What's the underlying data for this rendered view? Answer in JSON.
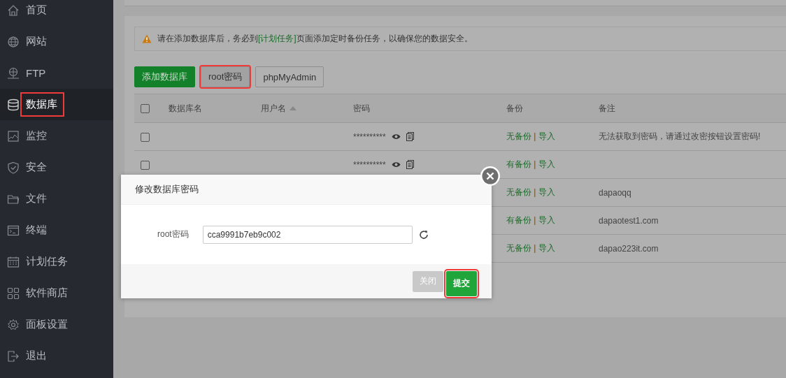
{
  "sidebar": {
    "items": [
      {
        "label": "首页",
        "selected": false,
        "highlighted": false
      },
      {
        "label": "网站",
        "selected": false,
        "highlighted": false
      },
      {
        "label": "FTP",
        "selected": false,
        "highlighted": false
      },
      {
        "label": "数据库",
        "selected": true,
        "highlighted": true
      },
      {
        "label": "监控",
        "selected": false,
        "highlighted": false
      },
      {
        "label": "安全",
        "selected": false,
        "highlighted": false
      },
      {
        "label": "文件",
        "selected": false,
        "highlighted": false
      },
      {
        "label": "终端",
        "selected": false,
        "highlighted": false
      },
      {
        "label": "计划任务",
        "selected": false,
        "highlighted": false
      },
      {
        "label": "软件商店",
        "selected": false,
        "highlighted": false
      },
      {
        "label": "面板设置",
        "selected": false,
        "highlighted": false
      },
      {
        "label": "退出",
        "selected": false,
        "highlighted": false
      }
    ]
  },
  "notice": {
    "before": "请在添加数据库后，务必到",
    "link": "[计划任务]",
    "after": "页面添加定时备份任务，以确保您的数据安全。"
  },
  "toolbar": [
    {
      "label": "添加数据库",
      "kind": "primary",
      "highlighted": false
    },
    {
      "label": "root密码",
      "kind": "default",
      "highlighted": true
    },
    {
      "label": "phpMyAdmin",
      "kind": "default",
      "highlighted": false
    }
  ],
  "table": {
    "all_checked": false,
    "columns": [
      "数据库名",
      "用户名",
      "密码",
      "备份",
      "备注"
    ],
    "rows": [
      {
        "checked": false,
        "password": "**********",
        "backup": "无备份",
        "separator": "|",
        "import": "导入",
        "note": "无法获取到密码，请通过改密按钮设置密码!"
      },
      {
        "checked": false,
        "password": "**********",
        "backup": "有备份",
        "separator": "|",
        "import": "导入"
      },
      {
        "backup": "无备份",
        "separator": "|",
        "import": "导入",
        "note": "dapaoqq"
      },
      {
        "backup": "有备份",
        "separator": "|",
        "import": "导入",
        "note": "dapaotest1.com"
      },
      {
        "backup": "无备份",
        "separator": "|",
        "import": "导入",
        "note": "dapao223it.com"
      }
    ]
  },
  "dialog": {
    "title": "修改数据库密码",
    "field_label": "root密码",
    "value": "cca9991b7eb9c002",
    "buttons": [
      {
        "label": "关闭",
        "kind": "cancel",
        "highlighted": false
      },
      {
        "label": "提交",
        "kind": "submit",
        "highlighted": true
      }
    ]
  }
}
